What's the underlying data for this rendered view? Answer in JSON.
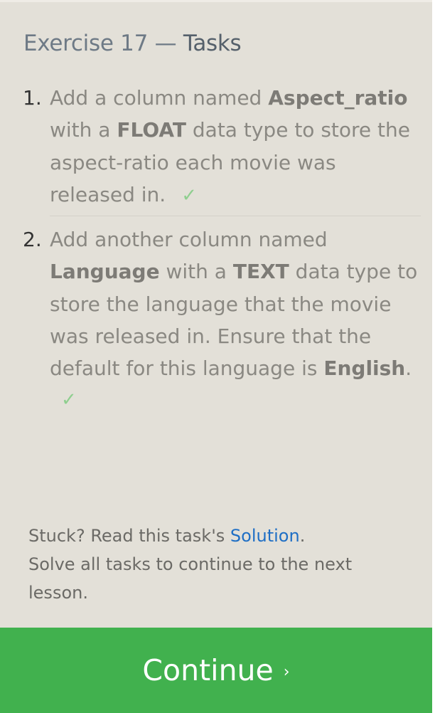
{
  "header": {
    "exercise": "Exercise 17",
    "separator": "—",
    "tasks_word": "Tasks"
  },
  "tasks": [
    {
      "number": "1.",
      "t1": "Add a column named ",
      "b1": "Aspect_ratio",
      "t2": " with a ",
      "b2": "FLOAT",
      "t3": " data type to store the aspect-ratio each movie was released in.",
      "check": "✓"
    },
    {
      "number": "2.",
      "t1": "Add another column named ",
      "b1": "Language",
      "t2": " with a ",
      "b2": "TEXT",
      "t3": " data type to store the language that the movie was released in. Ensure that the default for this language is ",
      "b3": "English",
      "t4": ".",
      "check": "✓"
    }
  ],
  "footer": {
    "stuck_prefix": "Stuck? Read this task's ",
    "solution_link": "Solution",
    "stuck_suffix": ".",
    "solve_all": "Solve all tasks to continue to the next lesson."
  },
  "continue_button": {
    "label": "Continue",
    "arrow": "›"
  },
  "colors": {
    "background": "#e3e0d8",
    "button": "#41b14e",
    "check": "#8fcf8f",
    "link": "#1f6fc5"
  }
}
